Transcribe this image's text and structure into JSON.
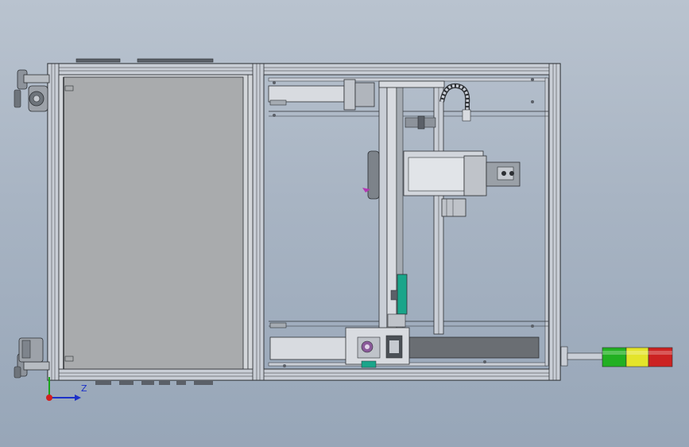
{
  "viewport": {
    "name": "solidworks-graphics-area",
    "background_top": "#b9c3cf",
    "background_bottom": "#97a6b8"
  },
  "triad": {
    "z_label": "Z",
    "x_axis_color": "#d21f1f",
    "z_axis_color": "#1c31c8",
    "y_axis_color": "#1aa51a"
  },
  "tower_light": {
    "segments": [
      {
        "name": "green",
        "color": "#22b022"
      },
      {
        "name": "yellow",
        "color": "#e4e42a"
      },
      {
        "name": "red",
        "color": "#cc2222"
      }
    ]
  },
  "model": {
    "frame_color": "#c9ced6",
    "frame_stroke": "#2c2f33",
    "panel_color": "#a9abad",
    "motor_color": "#bfc3c9",
    "rail_accent": "#1aa58a"
  }
}
